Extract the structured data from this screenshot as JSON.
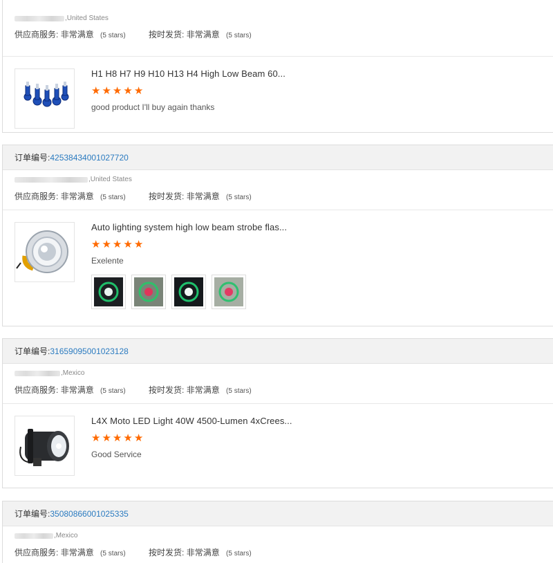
{
  "labels": {
    "order_number": "订单编号:",
    "supplier_service": "供应商服务:",
    "on_time_shipping": "按时发货:",
    "rating_value": "非常满意",
    "rating_stars": "(5 stars)"
  },
  "colors": {
    "star": "#ff6a00",
    "order_link": "#2b7bc0"
  },
  "reviews": [
    {
      "order_number": "",
      "buyer_country": ",United States",
      "product_title": "H1 H8 H7 H9 H10 H13 H4 High Low Beam 60...",
      "stars": 5,
      "comment": "good product I'll buy again thanks",
      "thumb_icon": "headlight-bulbs-icon"
    },
    {
      "order_number": "42538434001027720",
      "buyer_country": ",United States",
      "product_title": "Auto lighting system high low beam strobe flas...",
      "stars": 5,
      "comment": "Exelente",
      "thumb_icon": "projector-lens-icon",
      "photo_icons": [
        "review-photo-1",
        "review-photo-2",
        "review-photo-3",
        "review-photo-4"
      ]
    },
    {
      "order_number": "31659095001023128",
      "buyer_country": ",Mexico",
      "product_title": "L4X Moto LED Light 40W 4500-Lumen 4xCrees...",
      "stars": 5,
      "comment": "Good Service",
      "thumb_icon": "moto-spotlight-icon"
    },
    {
      "order_number": "35080866001025335",
      "buyer_country": ",Mexico"
    }
  ]
}
